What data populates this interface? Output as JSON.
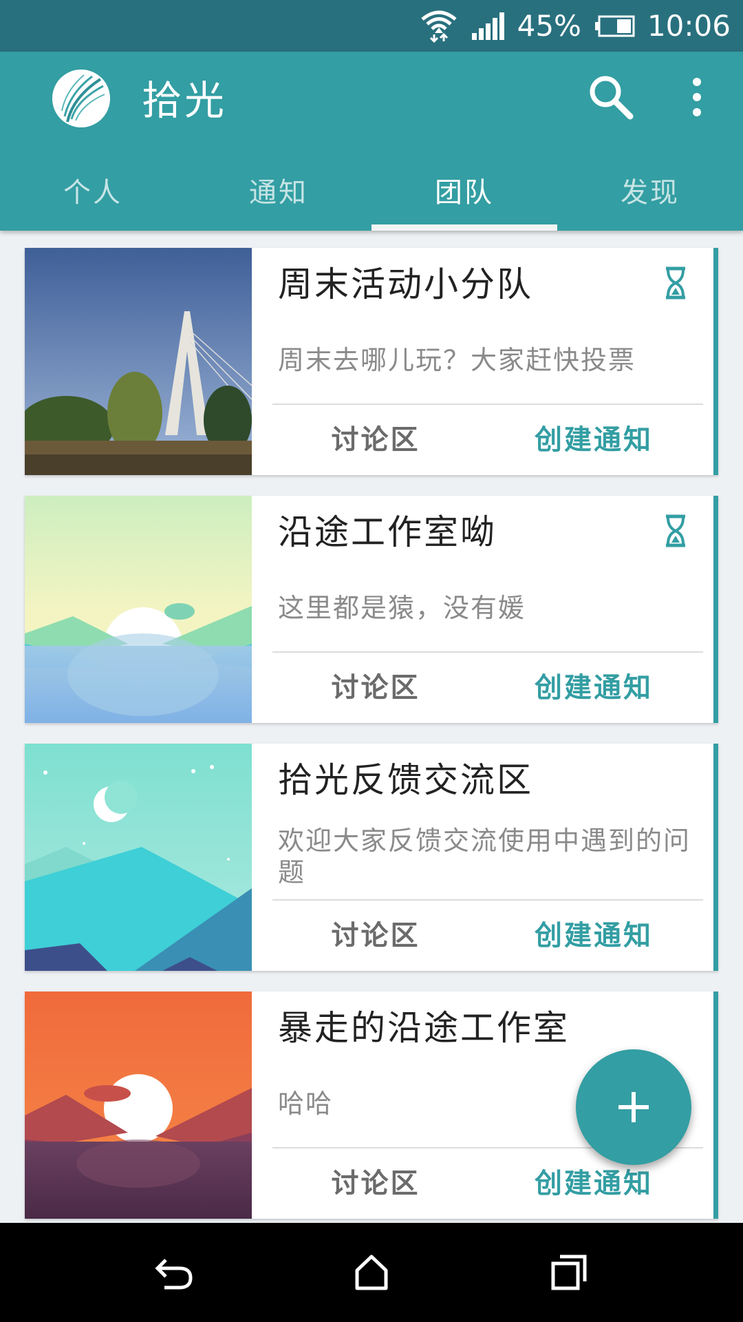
{
  "status_bar": {
    "battery_percent": "45%",
    "time": "10:06",
    "icons": [
      "wifi-icon",
      "signal-icon",
      "battery-icon"
    ]
  },
  "app_bar": {
    "title": "拾光",
    "icons": [
      "app-logo",
      "search-icon",
      "more-vert-icon"
    ]
  },
  "tabs": [
    {
      "label": "个人"
    },
    {
      "label": "通知"
    },
    {
      "label": "团队"
    },
    {
      "label": "发现"
    }
  ],
  "active_tab": "团队",
  "teams": [
    {
      "title": "周末活动小分队",
      "description": "周末去哪儿玩？大家赶快投票",
      "has_badge": true,
      "badge_icon": "hourglass-icon",
      "image": "bridge-photo",
      "discuss_label": "讨论区",
      "notify_label": "创建通知"
    },
    {
      "title": "沿途工作室呦",
      "description": "这里都是猿，没有媛",
      "has_badge": true,
      "badge_icon": "hourglass-icon",
      "image": "sunrise-lake-illustration",
      "discuss_label": "讨论区",
      "notify_label": "创建通知"
    },
    {
      "title": "拾光反馈交流区",
      "description": "欢迎大家反馈交流使用中遇到的问题",
      "has_badge": false,
      "image": "moon-mountain-illustration",
      "discuss_label": "讨论区",
      "notify_label": "创建通知"
    },
    {
      "title": "暴走的沿途工作室",
      "description": "哈哈",
      "has_badge": false,
      "image": "sunset-illustration",
      "discuss_label": "讨论区",
      "notify_label": "创建通知"
    }
  ],
  "fab": {
    "icon": "add-icon"
  },
  "nav_bar": {
    "icons": [
      "back-icon",
      "home-icon",
      "recents-icon"
    ]
  },
  "colors": {
    "primary": "#339ea3",
    "status_bar": "#29707e",
    "accent_text": "#339ea3"
  }
}
